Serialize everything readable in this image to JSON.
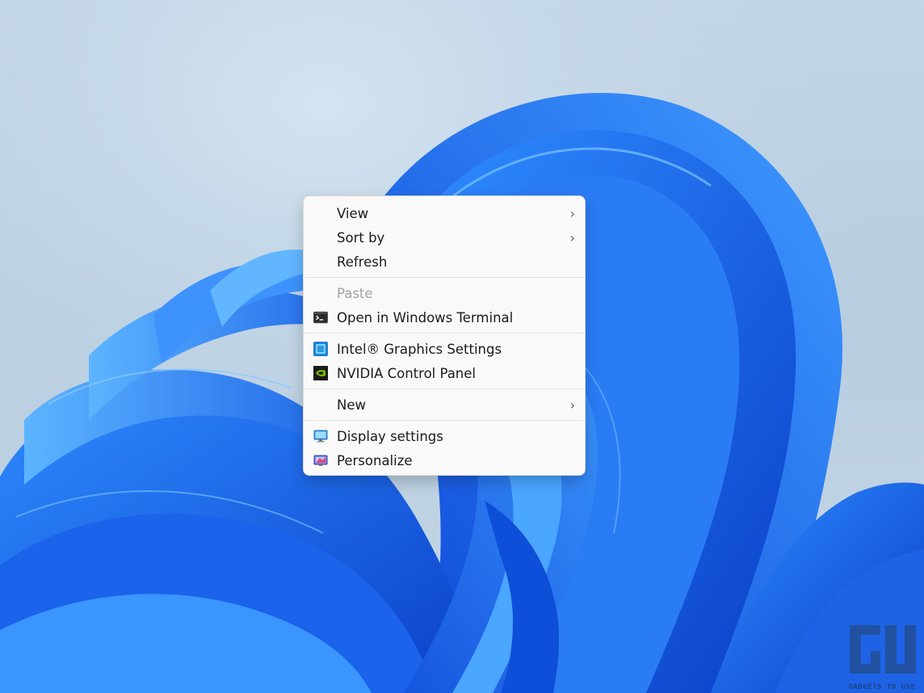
{
  "menu": {
    "items": [
      {
        "label": "View",
        "has_submenu": true
      },
      {
        "label": "Sort by",
        "has_submenu": true
      },
      {
        "label": "Refresh"
      },
      {
        "label": "Paste",
        "disabled": true
      },
      {
        "label": "Open in Windows Terminal",
        "icon": "terminal-icon"
      },
      {
        "label": "Intel® Graphics Settings",
        "icon": "intel-graphics-icon"
      },
      {
        "label": "NVIDIA Control Panel",
        "icon": "nvidia-icon"
      },
      {
        "label": "New",
        "has_submenu": true
      },
      {
        "label": "Display settings",
        "icon": "display-icon"
      },
      {
        "label": "Personalize",
        "icon": "personalize-icon"
      }
    ]
  },
  "colors": {
    "menu_background": "#f9f9f9",
    "disabled_text": "#a0a0a0",
    "wallpaper_accent": "#1560e6"
  },
  "watermark": {
    "logo_text": "GADGETS TO USE",
    "icon": "gadgets-to-use-logo"
  }
}
